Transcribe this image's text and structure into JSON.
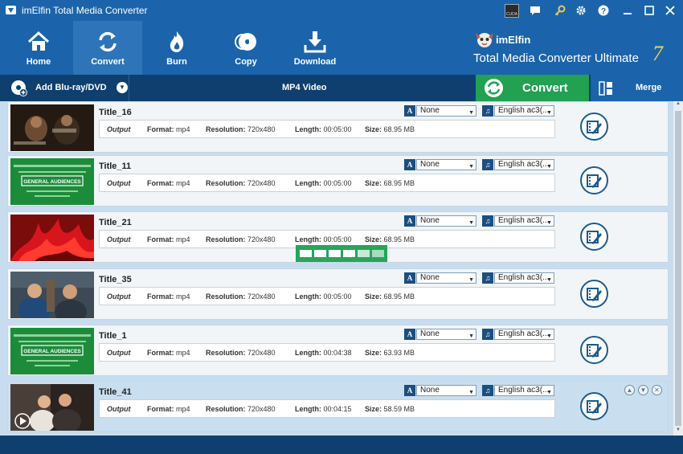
{
  "window": {
    "title": "imElfin Total Media Converter",
    "cuda_label": "CUDA"
  },
  "toolbar": {
    "items": [
      {
        "label": "Home",
        "icon": "home-icon"
      },
      {
        "label": "Convert",
        "icon": "convert-icon"
      },
      {
        "label": "Burn",
        "icon": "burn-icon"
      },
      {
        "label": "Copy",
        "icon": "copy-icon"
      },
      {
        "label": "Download",
        "icon": "download-icon"
      }
    ],
    "active_index": 1
  },
  "brand": {
    "name": "imElfin",
    "product": "Total Media Converter Ultimate",
    "version": "7"
  },
  "actionbar": {
    "add_label": "Add Blu-ray/DVD",
    "format_label": "MP4 Video",
    "convert_label": "Convert",
    "merge_label": "Merge"
  },
  "labels": {
    "output": "Output",
    "format": "Format:",
    "resolution": "Resolution:",
    "length": "Length:",
    "size": "Size:"
  },
  "colors": {
    "titlebar": "#1b64ab",
    "convert_green": "#22a152",
    "actionbar": "#0e3f6e"
  },
  "rows": [
    {
      "title": "Title_16",
      "format": "mp4",
      "resolution": "720x480",
      "length": "00:05:00",
      "size": "68.95 MB",
      "subtitle": "None",
      "audio": "English ac3(...",
      "thumb": "dark-scene"
    },
    {
      "title": "Title_11",
      "format": "mp4",
      "resolution": "720x480",
      "length": "00:05:00",
      "size": "68.95 MB",
      "subtitle": "None",
      "audio": "English ac3(...",
      "thumb": "green-rating",
      "thumb_text": "GENERAL AUDIENCES"
    },
    {
      "title": "Title_21",
      "format": "mp4",
      "resolution": "720x480",
      "length": "00:05:00",
      "size": "68.95 MB",
      "subtitle": "None",
      "audio": "English ac3(...",
      "thumb": "red-abstract"
    },
    {
      "title": "Title_35",
      "format": "mp4",
      "resolution": "720x480",
      "length": "00:05:00",
      "size": "68.95 MB",
      "subtitle": "None",
      "audio": "English ac3(...",
      "thumb": "two-men"
    },
    {
      "title": "Title_1",
      "format": "mp4",
      "resolution": "720x480",
      "length": "00:04:38",
      "size": "63.93 MB",
      "subtitle": "None",
      "audio": "English ac3(...",
      "thumb": "green-rating",
      "thumb_text": "GENERAL AUDIENCES"
    },
    {
      "title": "Title_41",
      "format": "mp4",
      "resolution": "720x480",
      "length": "00:04:15",
      "size": "58.59 MB",
      "subtitle": "None",
      "audio": "English ac3(...",
      "thumb": "couple-scene"
    }
  ],
  "progress": {
    "filled_segments": 6,
    "total_segments": 6
  }
}
